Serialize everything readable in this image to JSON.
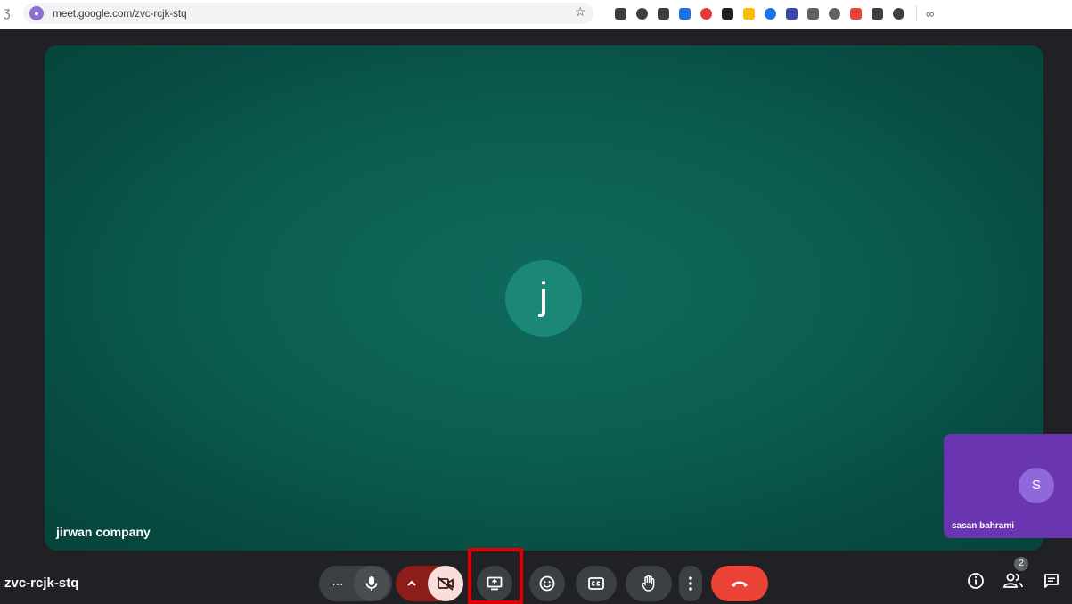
{
  "browser": {
    "url": "meet.google.com/zvc-rcjk-stq",
    "reload_glyph": "Ʒ",
    "star_icon": "☆",
    "extension_colors": [
      "#3c4043",
      "#3c4043",
      "#3c4043",
      "#1a73e8",
      "#e53935",
      "#202124",
      "#fbbc04",
      "#1a73e8",
      "#3949ab",
      "#5f6368",
      "#5f6368",
      "#ea4335",
      "#3c4043",
      "#3c4043"
    ],
    "profile_glyph": "∞"
  },
  "main_tile": {
    "participant_initial": "j",
    "participant_name": "jirwan company",
    "background_color": "#0b5d51",
    "avatar_color": "#1a8777"
  },
  "self_tile": {
    "participant_initial": "S",
    "participant_name": "sasan bahrami",
    "background_color": "#6a35b0"
  },
  "bottom_bar": {
    "meeting_code": "zvc-rcjk-stq",
    "more_label": "···",
    "participant_count": "2",
    "controls": [
      "more-options-icon",
      "microphone-icon",
      "camera-options-chevron-icon",
      "camera-off-icon",
      "present-screen-icon",
      "emoji-reaction-icon",
      "captions-icon",
      "raise-hand-icon",
      "more-vert-icon",
      "end-call-icon"
    ],
    "right_controls": [
      "meeting-details-icon",
      "people-icon",
      "chat-icon"
    ],
    "highlighted_control": "present-screen-icon",
    "colors": {
      "control_bg": "#3c4043",
      "camera_off_bg": "#f9dedc",
      "camera_chevron_bg": "#8c1d18",
      "end_call_bg": "#ea4335",
      "highlight": "#e00000"
    }
  }
}
